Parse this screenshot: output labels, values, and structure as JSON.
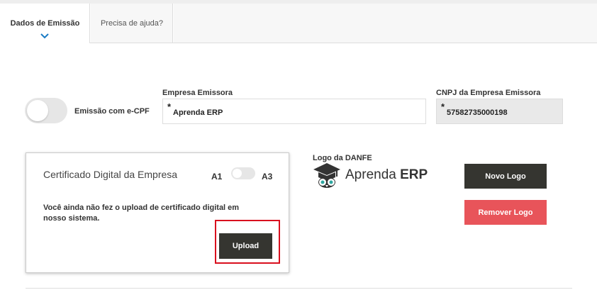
{
  "tabs": [
    {
      "label": "Dados de Emissão",
      "active": true
    },
    {
      "label": "Precisa de ajuda?",
      "active": false
    }
  ],
  "ecpf": {
    "label": "Emissão com e-CPF",
    "enabled": false
  },
  "empresa": {
    "label": "Empresa Emissora",
    "required_mark": "*",
    "value": "Aprenda ERP"
  },
  "cnpj": {
    "label": "CNPJ da Empresa Emissora",
    "required_mark": "*",
    "value": "57582735000198"
  },
  "certificado": {
    "title": "Certificado Digital da Empresa",
    "option_a1": "A1",
    "option_a3": "A3",
    "message": "Você ainda não fez o upload de certificado digital em nosso sistema.",
    "upload_label": "Upload"
  },
  "logo": {
    "label": "Logo da DANFE",
    "brand_light": "Aprenda",
    "brand_bold": "ERP",
    "novo_label": "Novo Logo",
    "remover_label": "Remover Logo"
  },
  "colors": {
    "dark_button": "#353530",
    "danger_button": "#e8545a",
    "accent": "#1a7bc4",
    "highlight": "#d9101e"
  },
  "icons": {
    "tab_indicator": "chevron-down-icon",
    "logo": "graduation-cap-owl-icon"
  }
}
